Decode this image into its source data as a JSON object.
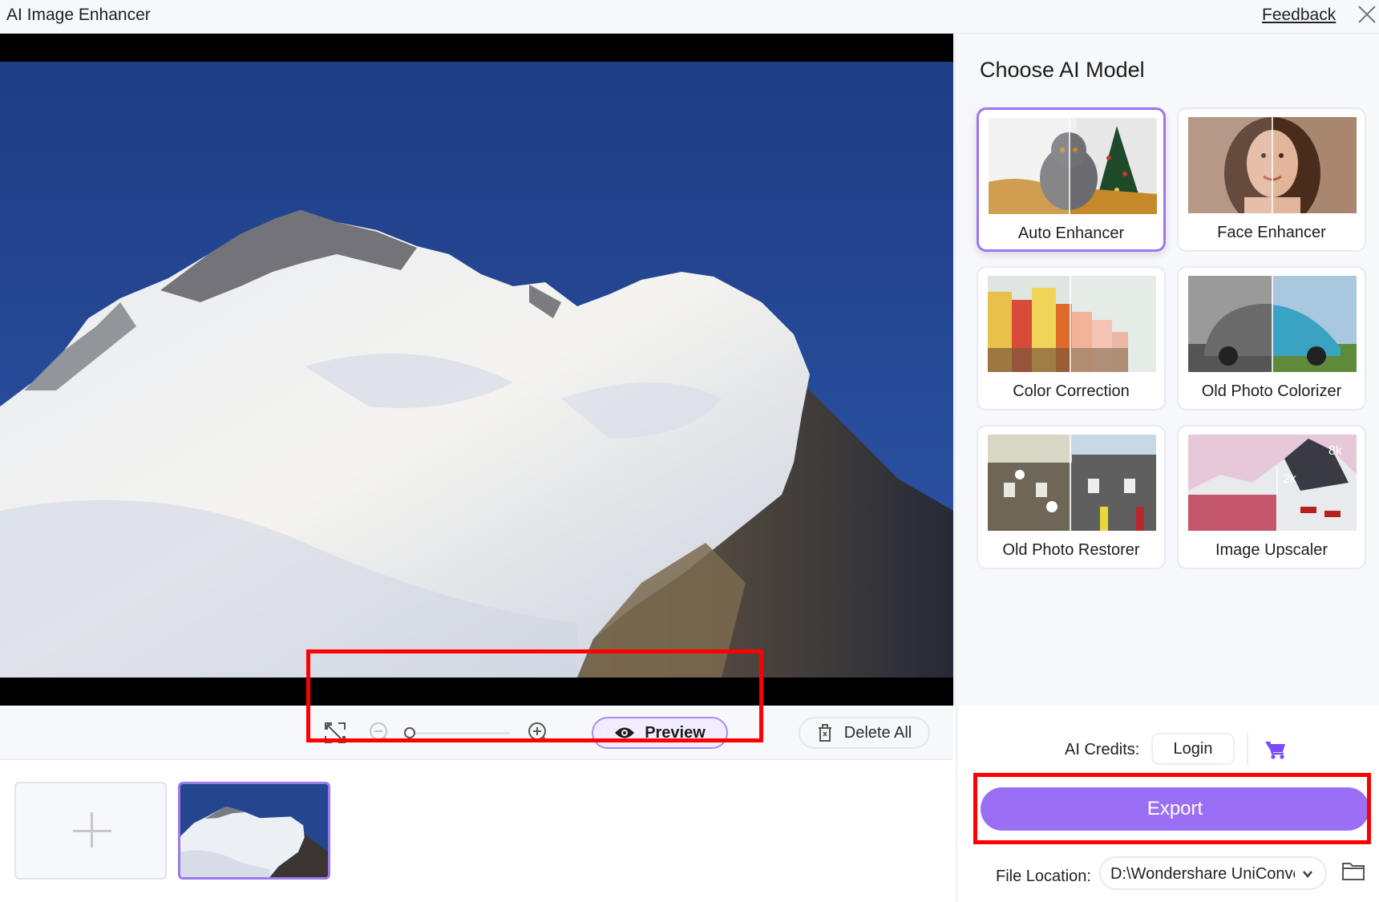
{
  "window": {
    "title": "AI Image Enhancer",
    "feedback_label": "Feedback",
    "close_icon": "close-icon"
  },
  "toolbar": {
    "fit_icon": "fit-screen-icon",
    "zoom_out_icon": "zoom-out-icon",
    "zoom_in_icon": "zoom-in-icon",
    "zoom_level": 0,
    "preview_label": "Preview",
    "preview_icon": "eye-icon",
    "delete_all_label": "Delete All",
    "delete_icon": "trash-icon"
  },
  "thumbnails": {
    "add_icon": "plus-icon",
    "items": [
      {
        "name": "mountain-snow",
        "selected": true
      }
    ]
  },
  "models": {
    "heading": "Choose AI Model",
    "items": [
      {
        "label": "Auto Enhancer",
        "selected": true
      },
      {
        "label": "Face Enhancer",
        "selected": false
      },
      {
        "label": "Color Correction",
        "selected": false
      },
      {
        "label": "Old Photo Colorizer",
        "selected": false
      },
      {
        "label": "Old Photo Restorer",
        "selected": false
      },
      {
        "label": "Image Upscaler",
        "selected": false,
        "badge_from": "2k",
        "badge_to": "8k"
      }
    ]
  },
  "export": {
    "credits_label": "AI Credits:",
    "login_label": "Login",
    "cart_icon": "cart-icon",
    "export_label": "Export",
    "file_location_label": "File Location:",
    "file_location_value": "D:\\Wondershare UniConverter",
    "folder_icon": "folder-icon"
  },
  "colors": {
    "accent": "#9a6ff6",
    "accent_border": "#9b78ef",
    "cart": "#7a4cf5",
    "highlight": "#ff0000"
  }
}
